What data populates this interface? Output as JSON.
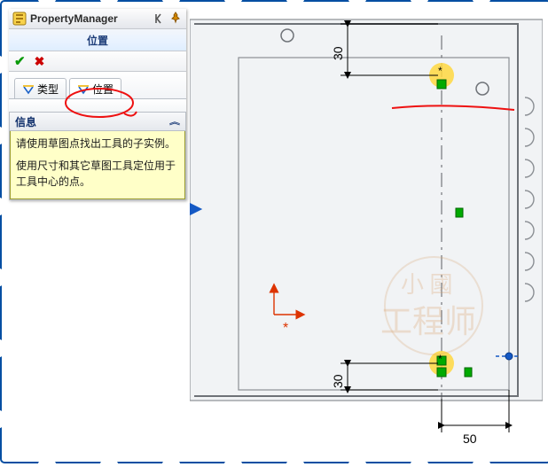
{
  "pm": {
    "title": "PropertyManager",
    "subtitle": "位置",
    "ok_tip": "OK",
    "cancel_tip": "Cancel",
    "tabs": [
      {
        "id": "type",
        "label": "类型",
        "active": false
      },
      {
        "id": "position",
        "label": "位置",
        "active": true
      }
    ],
    "section": {
      "header": "信息",
      "line1": "请使用草图点找出工具的子实例。",
      "line2": "使用尺寸和其它草图工具定位用于工具中心的点。"
    }
  },
  "dims": {
    "top": {
      "value": "30"
    },
    "bottom": {
      "value": "30"
    },
    "right": {
      "value": "50"
    }
  },
  "watermark": {
    "line1": "小 國",
    "line2": "工程师"
  }
}
